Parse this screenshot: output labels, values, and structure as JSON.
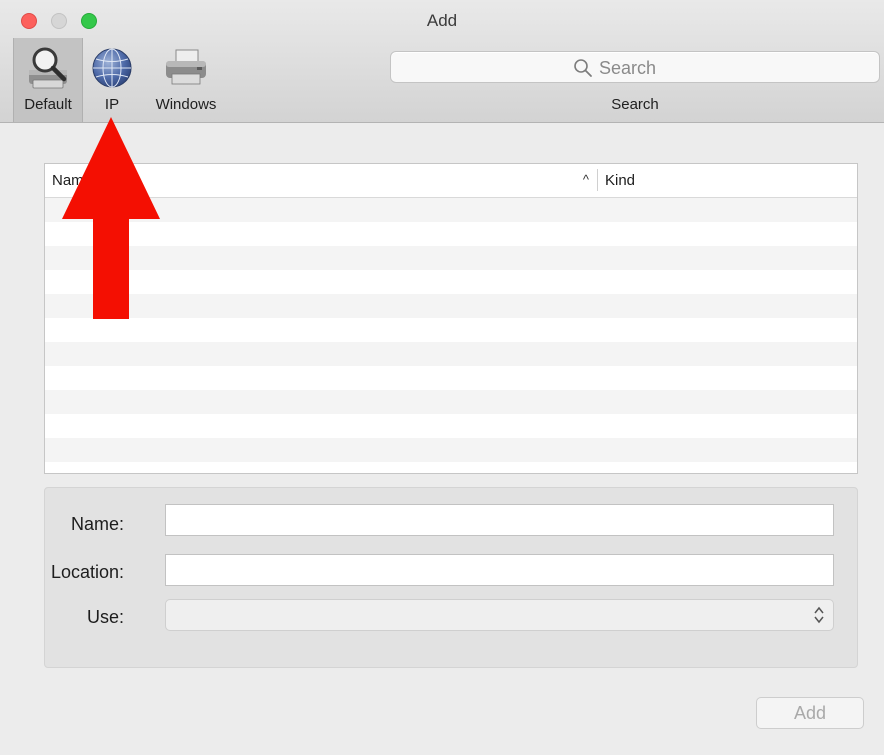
{
  "window": {
    "title": "Add"
  },
  "toolbar": {
    "items": [
      {
        "label": "Default",
        "icon": "default-printer-magnifier-icon",
        "selected": true
      },
      {
        "label": "IP",
        "icon": "globe-network-icon",
        "selected": false
      },
      {
        "label": "Windows",
        "icon": "windows-printer-icon",
        "selected": false
      }
    ],
    "search": {
      "placeholder": "Search",
      "caption": "Search"
    }
  },
  "table": {
    "columns": [
      {
        "label": "Name",
        "sort": "^"
      },
      {
        "label": "Kind"
      }
    ],
    "rows": []
  },
  "form": {
    "name_label": "Name:",
    "location_label": "Location:",
    "use_label": "Use:",
    "name_value": "",
    "location_value": "",
    "use_value": ""
  },
  "footer": {
    "add_label": "Add"
  },
  "annotation": {
    "arrow_color": "#f40f02",
    "points_to": "IP"
  },
  "colors": {
    "close": "#fc605c",
    "zoom": "#34c84a",
    "toolbar": "#d6d6d6"
  }
}
